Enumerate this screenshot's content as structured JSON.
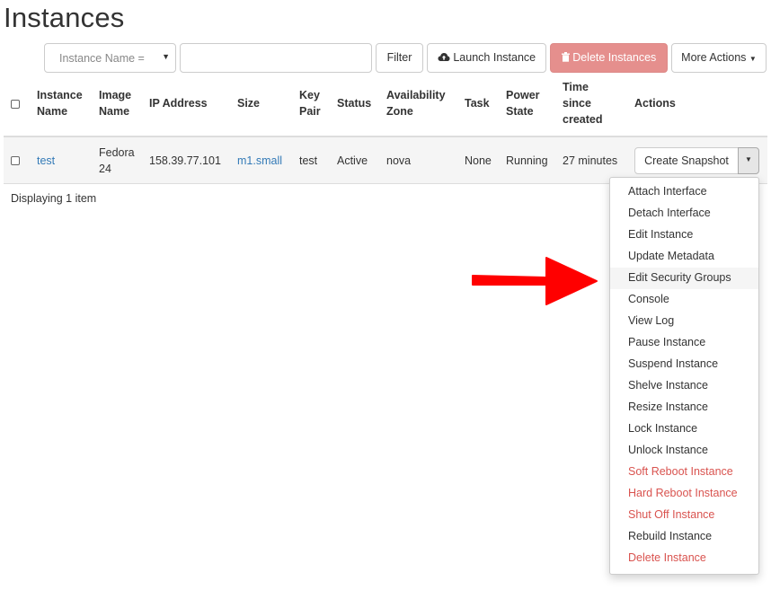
{
  "page": {
    "title": "Instances"
  },
  "toolbar": {
    "filter_select": "Instance Name =",
    "search_value": "",
    "filter_label": "Filter",
    "launch_label": "Launch Instance",
    "delete_label": "Delete Instances",
    "more_label": "More Actions"
  },
  "table": {
    "headers": {
      "name": [
        "Instance",
        "Name"
      ],
      "image": [
        "Image",
        "Name"
      ],
      "ip": [
        "IP Address"
      ],
      "size": [
        "Size"
      ],
      "keypair": [
        "Key",
        "Pair"
      ],
      "status": [
        "Status"
      ],
      "zone": [
        "Availability",
        "Zone"
      ],
      "task": [
        "Task"
      ],
      "power": [
        "Power",
        "State"
      ],
      "time": [
        "Time",
        "since",
        "created"
      ],
      "actions": [
        "Actions"
      ]
    },
    "row": {
      "name": "test",
      "image": [
        "Fedora",
        "24"
      ],
      "ip": "158.39.77.101",
      "size": "m1.small",
      "keypair": "test",
      "status": "Active",
      "zone": "nova",
      "task": "None",
      "power": "Running",
      "time": "27 minutes",
      "action_button": "Create Snapshot"
    },
    "footer": "Displaying 1 item"
  },
  "menu": {
    "items": [
      {
        "label": "Attach Interface",
        "danger": false
      },
      {
        "label": "Detach Interface",
        "danger": false
      },
      {
        "label": "Edit Instance",
        "danger": false
      },
      {
        "label": "Update Metadata",
        "danger": false
      },
      {
        "label": "Edit Security Groups",
        "danger": false,
        "highlighted": true
      },
      {
        "label": "Console",
        "danger": false
      },
      {
        "label": "View Log",
        "danger": false
      },
      {
        "label": "Pause Instance",
        "danger": false
      },
      {
        "label": "Suspend Instance",
        "danger": false
      },
      {
        "label": "Shelve Instance",
        "danger": false
      },
      {
        "label": "Resize Instance",
        "danger": false
      },
      {
        "label": "Lock Instance",
        "danger": false
      },
      {
        "label": "Unlock Instance",
        "danger": false
      },
      {
        "label": "Soft Reboot Instance",
        "danger": true
      },
      {
        "label": "Hard Reboot Instance",
        "danger": true
      },
      {
        "label": "Shut Off Instance",
        "danger": true
      },
      {
        "label": "Rebuild Instance",
        "danger": false
      },
      {
        "label": "Delete Instance",
        "danger": true
      }
    ]
  },
  "colors": {
    "link": "#337ab7",
    "danger": "#d9534f",
    "delete_button_bg": "#e58f8d",
    "annotation_arrow": "#ff0000"
  }
}
